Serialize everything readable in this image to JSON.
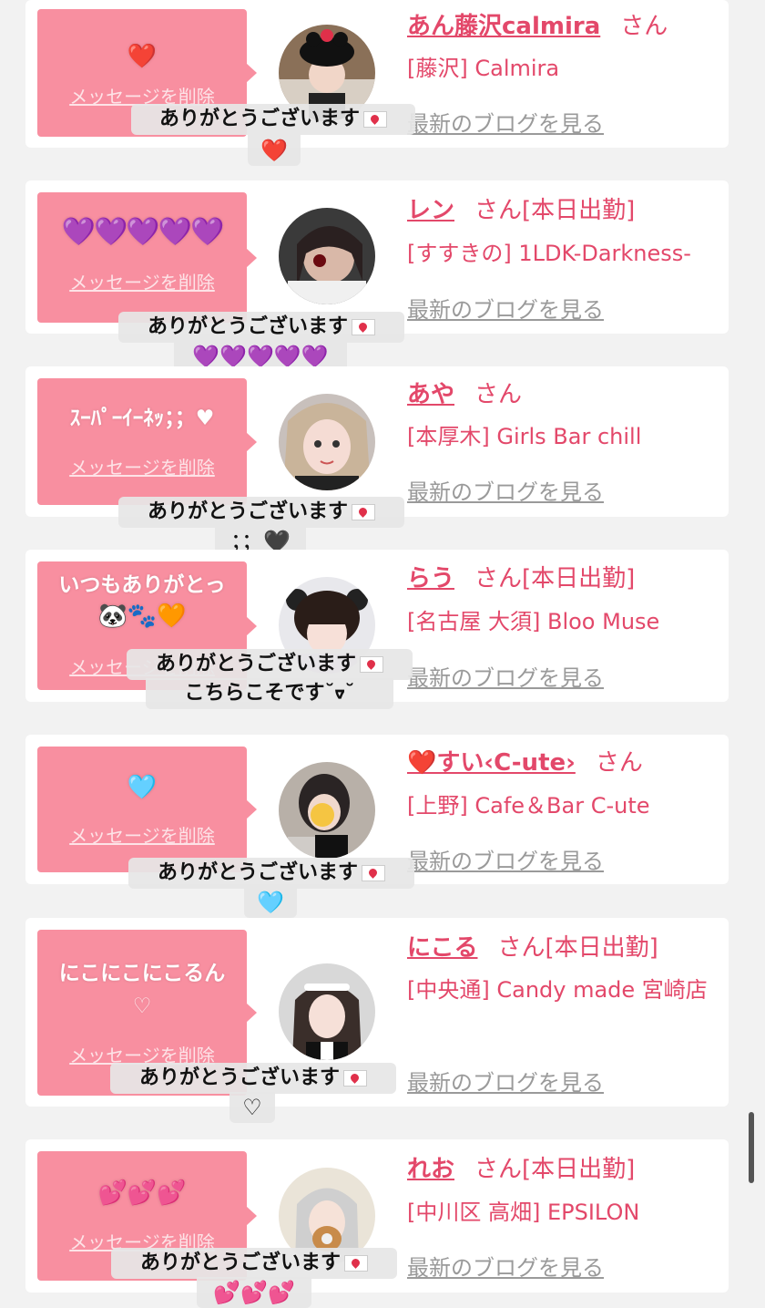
{
  "common": {
    "delete_label": "メッセージを削除",
    "san": "さん",
    "blog_link": "最新のブログを見る",
    "reply_text": "ありがとうございます",
    "today_badge": "[本日出勤]"
  },
  "cards": [
    {
      "bubble_message": "❤️",
      "name": "あん藤沢calmira",
      "shop": "[藤沢] Calmira",
      "reply_extra": "❤️"
    },
    {
      "bubble_message": "💜💜💜💜💜",
      "name": "レン",
      "shop": "[すすきの] 1LDK-Darkness-",
      "reply_extra": "💜💜💜💜💜"
    },
    {
      "bubble_message": "ｽｰﾊﾟｰｲｰﾈｯ；；♥",
      "name": "あや",
      "shop": "[本厚木] Girls Bar chill",
      "reply_extra": "；；🖤"
    },
    {
      "bubble_message": "いつもありがとっ",
      "bubble_message2": "🐼🐾🧡",
      "name": "らう",
      "shop": "[名古屋 大須] Bloo Muse",
      "reply_extra": "こちらこそです˘ᢦ˘"
    },
    {
      "bubble_message": "🩵",
      "name": "❤️すい‹C-ute›",
      "shop": "[上野] Cafe＆Bar C-ute",
      "reply_extra": "🩵"
    },
    {
      "bubble_message": "にこにこにこるん",
      "bubble_message2": "♡",
      "name": "にこる",
      "shop": "[中央通] Candy made 宮崎店",
      "reply_extra": "♡"
    },
    {
      "bubble_message": "💕💕💕",
      "name": "れお",
      "shop": "[中川区 高畑] EPSILON",
      "reply_extra": "💕💕💕"
    }
  ]
}
